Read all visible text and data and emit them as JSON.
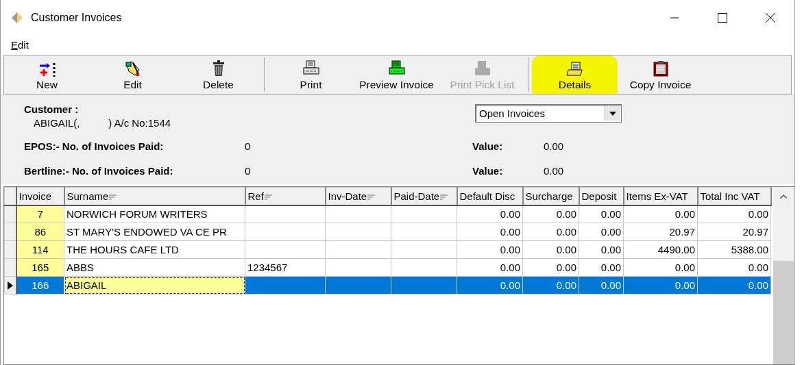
{
  "window": {
    "title": "Customer Invoices"
  },
  "menu": [
    {
      "label": "Edit"
    }
  ],
  "toolbar": [
    {
      "kind": "button",
      "label": "New",
      "disabled": false,
      "highlighted": false
    },
    {
      "kind": "button",
      "label": "Edit",
      "disabled": false,
      "highlighted": false
    },
    {
      "kind": "button",
      "label": "Delete",
      "disabled": false,
      "highlighted": false
    },
    {
      "kind": "separator"
    },
    {
      "kind": "button",
      "label": "Print",
      "disabled": false,
      "highlighted": false
    },
    {
      "kind": "button",
      "label": "Preview Invoice",
      "disabled": false,
      "highlighted": false
    },
    {
      "kind": "button",
      "label": "Print Pick List",
      "disabled": true,
      "highlighted": false
    },
    {
      "kind": "separator"
    },
    {
      "kind": "button",
      "label": "Details",
      "disabled": false,
      "highlighted": true
    },
    {
      "kind": "button",
      "label": "Copy Invoice",
      "disabled": false,
      "highlighted": false
    }
  ],
  "customer": {
    "label": "Customer :",
    "value": "ABIGAIL(,          ) A/c No:1544"
  },
  "filter": {
    "value": "Open Invoices"
  },
  "stats": [
    {
      "label": "EPOS:- No. of Invoices Paid:",
      "count": "0",
      "value_label": "Value:",
      "value": "0.00"
    },
    {
      "label": "Bertline:- No. of Invoices Paid:",
      "count": "0",
      "value_label": "Value:",
      "value": "0.00"
    }
  ],
  "table": {
    "columns": [
      {
        "label": "Invoice",
        "sortable": false,
        "highlighted": true
      },
      {
        "label": "Surname",
        "sortable": true,
        "highlighted": false
      },
      {
        "label": "Ref",
        "sortable": true,
        "highlighted": false
      },
      {
        "label": "Inv-Date",
        "sortable": true,
        "highlighted": false
      },
      {
        "label": "Paid-Date",
        "sortable": true,
        "highlighted": false
      },
      {
        "label": "Default Disc",
        "sortable": false,
        "highlighted": false
      },
      {
        "label": "Surcharge",
        "sortable": false,
        "highlighted": false
      },
      {
        "label": "Deposit",
        "sortable": false,
        "highlighted": false
      },
      {
        "label": "Items Ex-VAT",
        "sortable": false,
        "highlighted": false
      },
      {
        "label": "Total Inc VAT",
        "sortable": false,
        "highlighted": false
      }
    ],
    "rows": [
      {
        "selected": false,
        "cells": [
          "7",
          "NORWICH FORUM WRITERS",
          "",
          "",
          "",
          "0.00",
          "0.00",
          "0.00",
          "0.00",
          "0.00"
        ]
      },
      {
        "selected": false,
        "cells": [
          "86",
          "ST MARY'S ENDOWED VA CE PR",
          "",
          "",
          "",
          "0.00",
          "0.00",
          "0.00",
          "20.97",
          "20.97"
        ]
      },
      {
        "selected": false,
        "cells": [
          "114",
          "THE HOURS CAFE LTD",
          "",
          "",
          "",
          "0.00",
          "0.00",
          "0.00",
          "4490.00",
          "5388.00"
        ]
      },
      {
        "selected": false,
        "cells": [
          "165",
          "ABBS",
          "1234567",
          "",
          "",
          "0.00",
          "0.00",
          "0.00",
          "0.00",
          "0.00"
        ]
      },
      {
        "selected": true,
        "cells": [
          "166",
          "ABIGAIL",
          "",
          "",
          "",
          "0.00",
          "0.00",
          "0.00",
          "0.00",
          "0.00"
        ]
      }
    ]
  }
}
